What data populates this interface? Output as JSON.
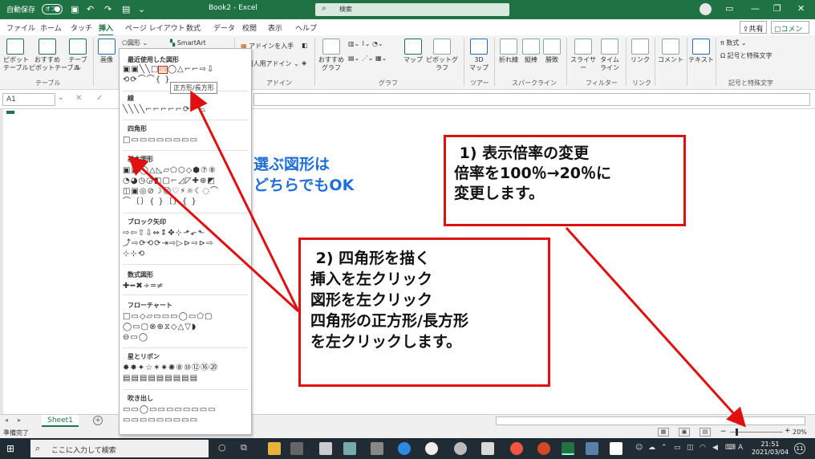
{
  "titlebar": {
    "autosave_label": "自動保存",
    "autosave_state": "オフ",
    "doc_title": "Book2 - Excel",
    "search_placeholder": "検索"
  },
  "tabs": [
    "ファイル",
    "ホーム",
    "タッチ",
    "挿入",
    "ページ レイアウト",
    "数式",
    "データ",
    "校閲",
    "表示",
    "ヘルプ"
  ],
  "active_tab": "挿入",
  "share_label": "共有",
  "comment_label": "コメント",
  "ribbon": {
    "pivot": "ピボット\nテーブル",
    "recommended_pivot": "おすすめ\nピボットテーブル",
    "table": "テーブル",
    "group_table": "テーブル",
    "image": "画像",
    "shapes": "図形",
    "smartart": "SmartArt",
    "addins_get": "アドインを入手",
    "addins_personal": "個人用アドイン",
    "group_addins": "アドイン",
    "recommended_charts": "おすすめ\nグラフ",
    "map": "マップ",
    "pivot_chart": "ピボットグラフ",
    "group_charts": "グラフ",
    "map3d": "3D\nマップ",
    "group_tour": "ツアー",
    "line": "折れ線",
    "column": "縦棒",
    "winloss": "勝敗",
    "group_sparklines": "スパークライン",
    "slicer": "スライサー",
    "timeline": "タイム\nライン",
    "group_filter": "フィルター",
    "link": "リンク",
    "group_link": "リンク",
    "comment": "コメント",
    "text": "テキスト",
    "equation": "数式",
    "symbol": "記号と特殊文字",
    "group_symbols": "記号と特殊文字"
  },
  "namebox": "A1",
  "shapes_menu": {
    "recent": "最近使用した図形",
    "lines": "線",
    "rectangles": "四角形",
    "basic": "基本図形",
    "block_arrows": "ブロック矢印",
    "equation_shapes": "数式図形",
    "flowchart": "フローチャート",
    "stars": "星とリボン",
    "callouts": "吹き出し",
    "tooltip": "正方形/長方形"
  },
  "sheet_tab": "Sheet1",
  "status_text": "準備完了",
  "zoom_label": "20%",
  "taskbar": {
    "search_placeholder": "ここに入力して検索",
    "time": "21:51",
    "date": "2021/03/04",
    "notification_count": "11"
  },
  "annotations": {
    "note_either": "選ぶ図形は\nどちらでもOK",
    "callout_zoom": " 1) 表示倍率の変更\n倍率を100％→20％に\n変更します。",
    "callout_shape": " 2) 四角形を描く\n挿入を左クリック\n図形を左クリック\n四角形の正方形/長方形\nを左クリックします。"
  },
  "colors": {
    "excel_green": "#1f7244",
    "annotation_red": "#e01010",
    "annotation_blue": "#1e6fd6",
    "taskbar": "#202b33"
  }
}
